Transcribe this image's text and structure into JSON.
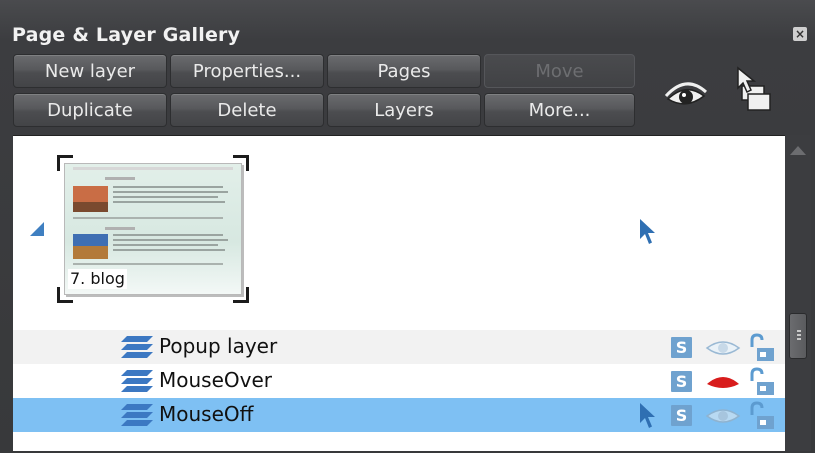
{
  "panel": {
    "title": "Page & Layer Gallery"
  },
  "buttons": {
    "new_layer": "New layer",
    "properties": "Properties...",
    "pages": "Pages",
    "move": "Move",
    "duplicate": "Duplicate",
    "delete": "Delete",
    "layers": "Layers",
    "more": "More..."
  },
  "toolbar_icons": [
    "show-all-layers-eye-icon",
    "multi-layer-select-icon"
  ],
  "page": {
    "label": "7. blog",
    "icon": "page-thumbnail"
  },
  "layers": [
    {
      "name": "Popup layer",
      "selected": false,
      "visible": true,
      "locked": false
    },
    {
      "name": "MouseOver",
      "selected": false,
      "visible": false,
      "locked": false
    },
    {
      "name": "MouseOff",
      "selected": true,
      "visible": true,
      "locked": false
    }
  ],
  "colors": {
    "selection": "#7ec0f3",
    "accent": "#3f7fc1",
    "panel_bg": "#3c3d40"
  }
}
